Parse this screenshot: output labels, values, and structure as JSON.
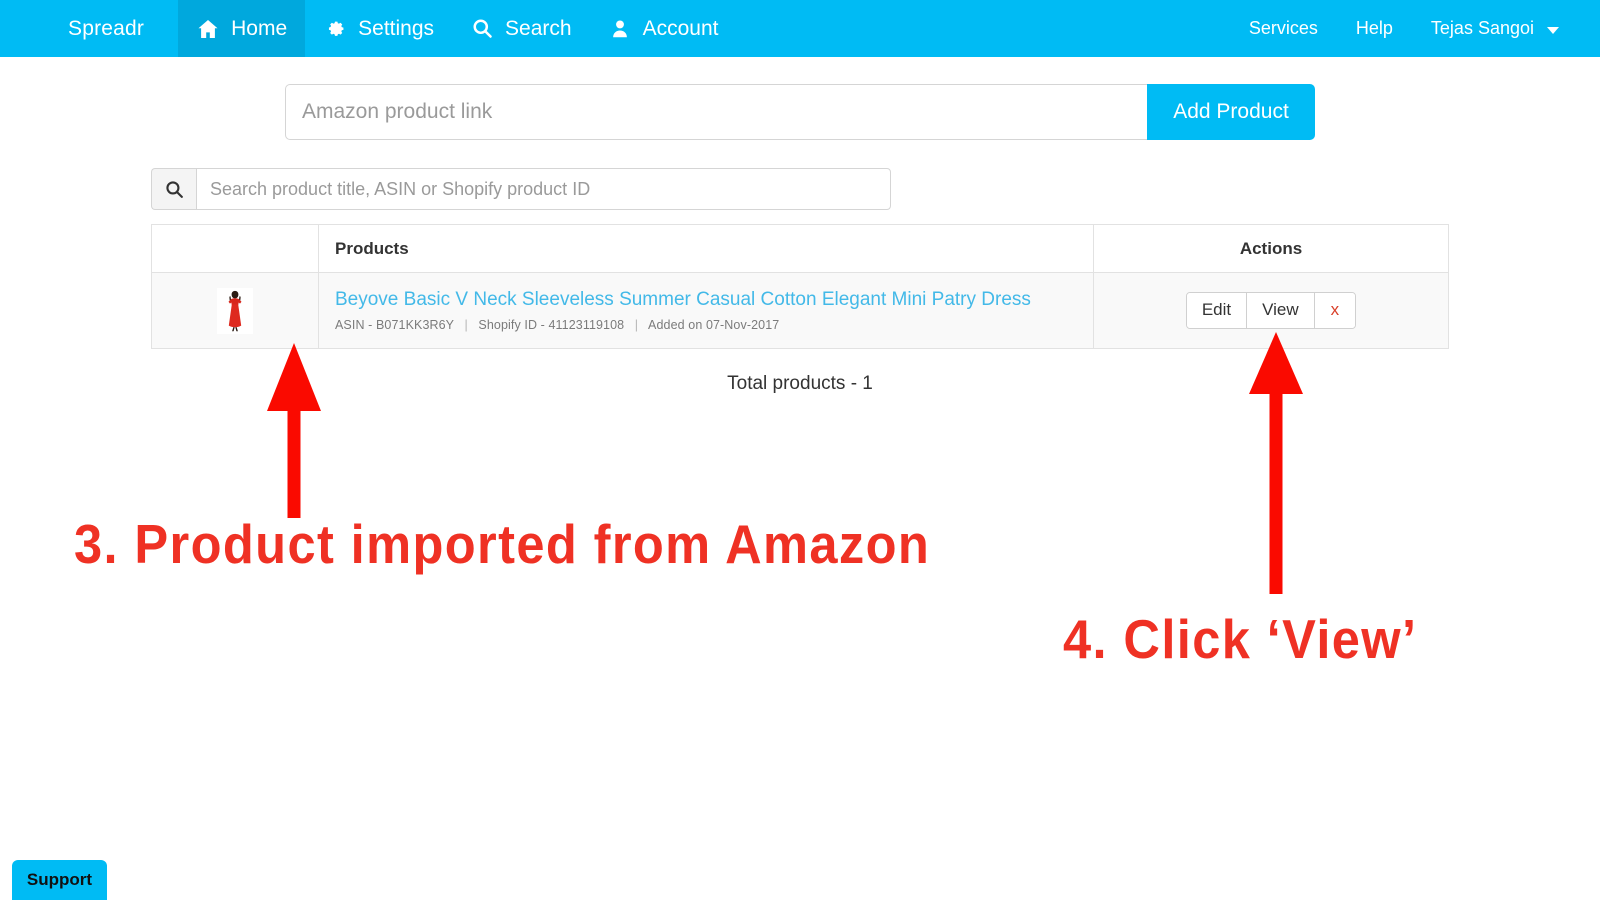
{
  "navbar": {
    "brand": "Spreadr",
    "left_items": [
      {
        "label": "Home",
        "icon": "home-icon",
        "active": true
      },
      {
        "label": "Settings",
        "icon": "gear-icon",
        "active": false
      },
      {
        "label": "Search",
        "icon": "search-icon",
        "active": false
      },
      {
        "label": "Account",
        "icon": "user-icon",
        "active": false
      }
    ],
    "right_items": [
      {
        "label": "Services"
      },
      {
        "label": "Help"
      },
      {
        "label": "Tejas Sangoi"
      }
    ],
    "background_color": "#00bbf4",
    "active_color": "#00a8dd"
  },
  "add_product": {
    "placeholder": "Amazon product link",
    "value": "",
    "button_label": "Add Product",
    "button_color": "#00bbf4"
  },
  "search": {
    "placeholder": "Search product title, ASIN or Shopify product ID",
    "value": "",
    "icon": "search-icon"
  },
  "table": {
    "headers": {
      "thumbnail": "",
      "products": "Products",
      "actions": "Actions"
    },
    "rows": [
      {
        "thumbnail_alt": "red sleeveless mini dress",
        "title": "Beyove Basic V Neck Sleeveless Summer Casual Cotton Elegant Mini Patry Dress",
        "asin_label": "ASIN - B071KK3R6Y",
        "shopify_label": "Shopify ID - 41123119108",
        "added_label": "Added on 07-Nov-2017",
        "separator": "|",
        "actions": {
          "edit": "Edit",
          "view": "View",
          "delete": "x"
        }
      }
    ]
  },
  "total_products": "Total products - 1",
  "annotations": [
    {
      "id": "annot-1",
      "text": "3. Product imported from Amazon",
      "color": "#ef3124"
    },
    {
      "id": "annot-2",
      "text": "4. Click ‘View’",
      "color": "#ef3124"
    }
  ],
  "support": {
    "label": "Support",
    "color": "#00bbf4"
  }
}
